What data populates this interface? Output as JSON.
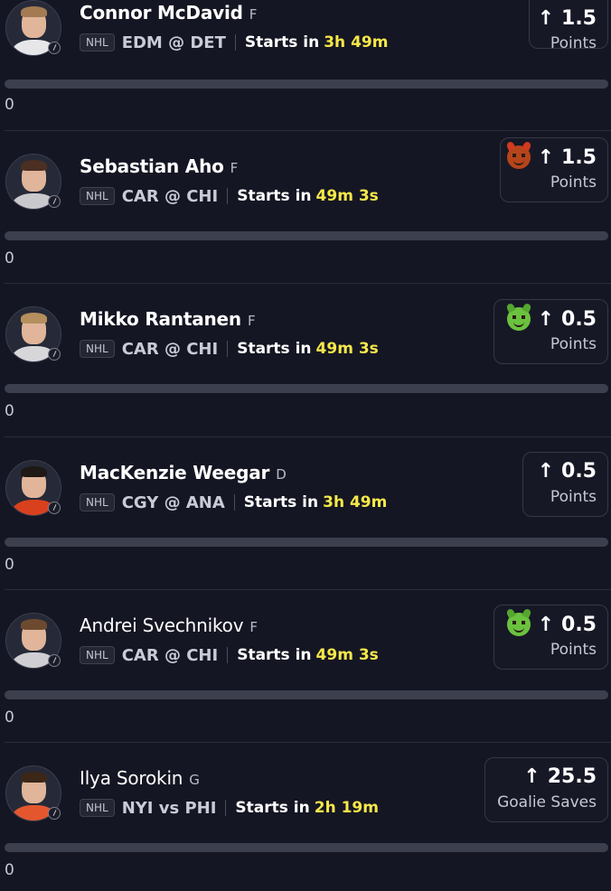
{
  "colors": {
    "background": "#151623",
    "countdown": "#f6e84a",
    "track": "#3c3f4d"
  },
  "props": [
    {
      "player": "Connor McDavid",
      "position": "F",
      "league": "NHL",
      "matchup": "EDM @ DET",
      "starts_label": "Starts in",
      "countdown": "3h 49m",
      "direction_icon": "up-arrow-icon",
      "arrow": "↑",
      "line": "1.5",
      "stat": "Points",
      "emoji": null,
      "progress": 0,
      "count": "0"
    },
    {
      "player": "Sebastian Aho",
      "position": "F",
      "league": "NHL",
      "matchup": "CAR @ CHI",
      "starts_label": "Starts in",
      "countdown": "49m 3s",
      "direction_icon": "up-arrow-icon",
      "arrow": "↑",
      "line": "1.5",
      "stat": "Points",
      "emoji": "red-devil-icon",
      "progress": 0,
      "count": "0"
    },
    {
      "player": "Mikko Rantanen",
      "position": "F",
      "league": "NHL",
      "matchup": "CAR @ CHI",
      "starts_label": "Starts in",
      "countdown": "49m 3s",
      "direction_icon": "up-arrow-icon",
      "arrow": "↑",
      "line": "0.5",
      "stat": "Points",
      "emoji": "green-devil-icon",
      "progress": 0,
      "count": "0"
    },
    {
      "player": "MacKenzie Weegar",
      "position": "D",
      "league": "NHL",
      "matchup": "CGY @ ANA",
      "starts_label": "Starts in",
      "countdown": "3h 49m",
      "direction_icon": "up-arrow-icon",
      "arrow": "↑",
      "line": "0.5",
      "stat": "Points",
      "emoji": null,
      "progress": 0,
      "count": "0"
    },
    {
      "player": "Andrei Svechnikov",
      "position": "F",
      "league": "NHL",
      "matchup": "CAR @ CHI",
      "starts_label": "Starts in",
      "countdown": "49m 3s",
      "direction_icon": "up-arrow-icon",
      "arrow": "↑",
      "line": "0.5",
      "stat": "Points",
      "emoji": "green-devil-icon",
      "progress": 0,
      "count": "0"
    },
    {
      "player": "Ilya Sorokin",
      "position": "G",
      "league": "NHL",
      "matchup": "NYI vs PHI",
      "starts_label": "Starts in",
      "countdown": "2h 19m",
      "direction_icon": "up-arrow-icon",
      "arrow": "↑",
      "line": "25.5",
      "stat": "Goalie Saves",
      "emoji": null,
      "progress": 0,
      "count": "0"
    }
  ]
}
